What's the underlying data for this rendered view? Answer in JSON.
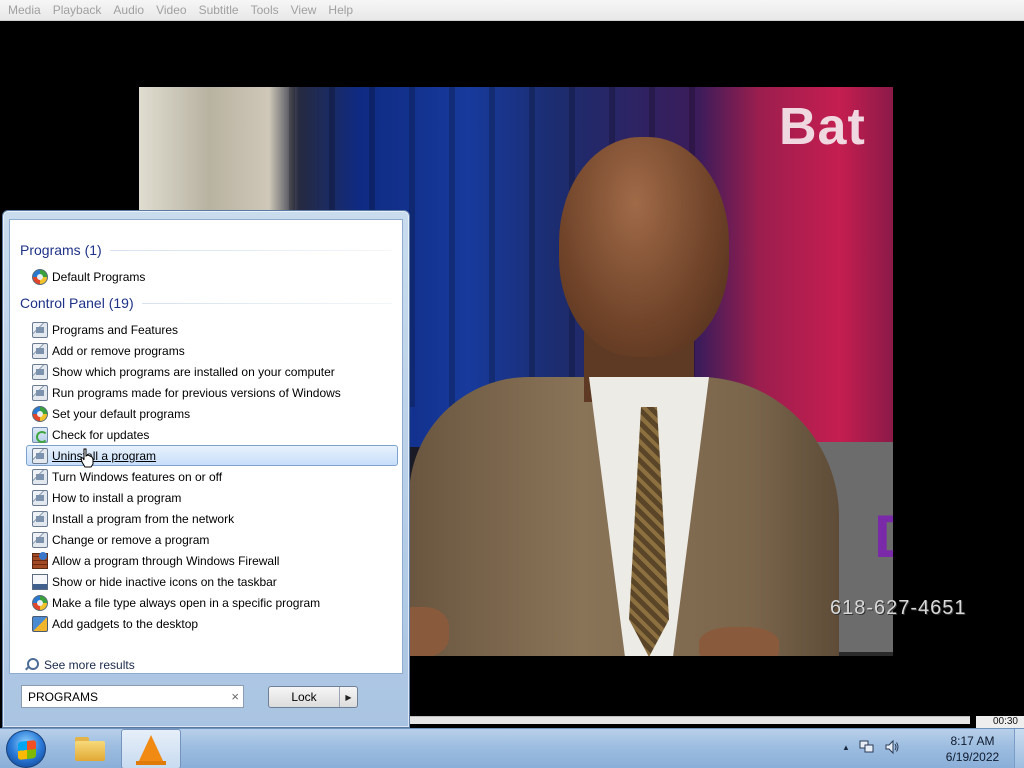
{
  "menubar": {
    "items": [
      "Media",
      "Playback",
      "Audio",
      "Video",
      "Subtitle",
      "Tools",
      "View",
      "Help"
    ]
  },
  "video": {
    "phone_number": "618-627-4651",
    "time_elapsed": "00:30"
  },
  "start_menu": {
    "groups": [
      {
        "header": "Programs (1)",
        "items": [
          {
            "label": "Default Programs",
            "icon": "globe-icon"
          }
        ]
      },
      {
        "header": "Control Panel (19)",
        "items": [
          {
            "label": "Programs and Features",
            "icon": "control-panel-icon"
          },
          {
            "label": "Add or remove programs",
            "icon": "control-panel-icon"
          },
          {
            "label": "Show which programs are installed on your computer",
            "icon": "control-panel-icon"
          },
          {
            "label": "Run programs made for previous versions of Windows",
            "icon": "control-panel-icon"
          },
          {
            "label": "Set your default programs",
            "icon": "globe-icon"
          },
          {
            "label": "Check for updates",
            "icon": "windows-update-icon"
          },
          {
            "label": "Uninstall a program",
            "icon": "control-panel-icon",
            "highlighted": true
          },
          {
            "label": "Turn Windows features on or off",
            "icon": "control-panel-icon"
          },
          {
            "label": "How to install a program",
            "icon": "control-panel-icon"
          },
          {
            "label": "Install a program from the network",
            "icon": "control-panel-icon"
          },
          {
            "label": "Change or remove a program",
            "icon": "control-panel-icon"
          },
          {
            "label": "Allow a program through Windows Firewall",
            "icon": "firewall-icon"
          },
          {
            "label": "Show or hide inactive icons on the taskbar",
            "icon": "taskbar-icon"
          },
          {
            "label": "Make a file type always open in a specific program",
            "icon": "globe-icon"
          },
          {
            "label": "Add gadgets to the desktop",
            "icon": "gadgets-icon"
          }
        ]
      }
    ],
    "see_more": "See more results",
    "search": {
      "value": "PROGRAMS",
      "clear_glyph": "×"
    },
    "lock_button": {
      "label": "Lock",
      "arrow_glyph": "▶"
    }
  },
  "taskbar": {
    "tray_up_arrow": "▲",
    "clock_time": "8:17 AM",
    "clock_date": "6/19/2022"
  }
}
